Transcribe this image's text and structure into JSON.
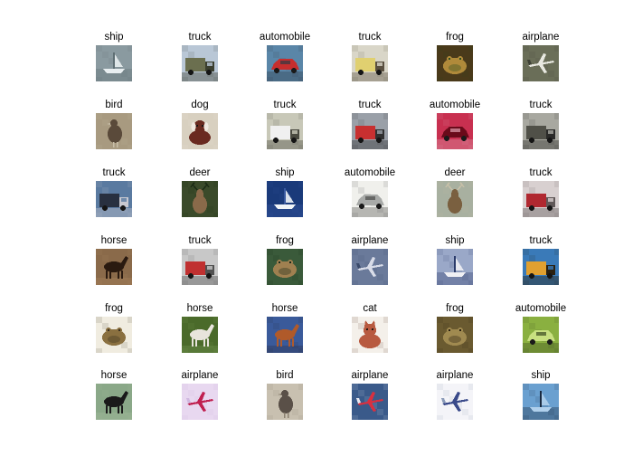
{
  "rows": [
    {
      "items": [
        {
          "label": "ship",
          "palette": [
            "#8a9aa0",
            "#e8eef0",
            "#5f6f74"
          ],
          "motif": "ship"
        },
        {
          "label": "truck",
          "palette": [
            "#b9c7d6",
            "#6b6f4f",
            "#3b3f2f"
          ],
          "motif": "truck"
        },
        {
          "label": "automobile",
          "palette": [
            "#5a86a8",
            "#c62e2e",
            "#2f3a45"
          ],
          "motif": "car"
        },
        {
          "label": "truck",
          "palette": [
            "#d9d6c8",
            "#e0d070",
            "#5a5040"
          ],
          "motif": "truck"
        },
        {
          "label": "frog",
          "palette": [
            "#4a3a1a",
            "#b08a3a",
            "#2c4a1f"
          ],
          "motif": "frog"
        },
        {
          "label": "airplane",
          "palette": [
            "#6a6e58",
            "#e8e8e0",
            "#3f4236"
          ],
          "motif": "plane"
        }
      ]
    },
    {
      "items": [
        {
          "label": "bird",
          "palette": [
            "#a89a80",
            "#5a4a3a",
            "#c8bea8"
          ],
          "motif": "bird"
        },
        {
          "label": "dog",
          "palette": [
            "#d8d0c0",
            "#6a2a20",
            "#f0e8e0"
          ],
          "motif": "dog"
        },
        {
          "label": "truck",
          "palette": [
            "#c8c8b8",
            "#f0f0f0",
            "#4a4a40"
          ],
          "motif": "truck"
        },
        {
          "label": "truck",
          "palette": [
            "#9aa0a8",
            "#c83030",
            "#303030"
          ],
          "motif": "truck"
        },
        {
          "label": "automobile",
          "palette": [
            "#c83050",
            "#6a0a1a",
            "#e0a0b0"
          ],
          "motif": "car"
        },
        {
          "label": "truck",
          "palette": [
            "#a8a8a0",
            "#505048",
            "#2a2a28"
          ],
          "motif": "truck"
        }
      ]
    },
    {
      "items": [
        {
          "label": "truck",
          "palette": [
            "#5a7aa0",
            "#283040",
            "#c8c8d0"
          ],
          "motif": "truck"
        },
        {
          "label": "deer",
          "palette": [
            "#3a4a2a",
            "#8a6a4a",
            "#1a2a14"
          ],
          "motif": "deer"
        },
        {
          "label": "ship",
          "palette": [
            "#1a3a7a",
            "#f0f4f8",
            "#3a5aa0"
          ],
          "motif": "ship"
        },
        {
          "label": "automobile",
          "palette": [
            "#f0f0ec",
            "#a8aaa8",
            "#4a4a48"
          ],
          "motif": "car"
        },
        {
          "label": "deer",
          "palette": [
            "#a8b0a0",
            "#7a6040",
            "#c8c0a8"
          ],
          "motif": "deer"
        },
        {
          "label": "truck",
          "palette": [
            "#d8d0d0",
            "#b02830",
            "#605858"
          ],
          "motif": "truck"
        }
      ]
    },
    {
      "items": [
        {
          "label": "horse",
          "palette": [
            "#8a6a4a",
            "#2a1a10",
            "#b08860"
          ],
          "motif": "horse"
        },
        {
          "label": "truck",
          "palette": [
            "#c8c8c8",
            "#c03030",
            "#505050"
          ],
          "motif": "truck"
        },
        {
          "label": "frog",
          "palette": [
            "#3a5a3a",
            "#a08050",
            "#1a2a1a"
          ],
          "motif": "frog"
        },
        {
          "label": "airplane",
          "palette": [
            "#6a7a9a",
            "#d8dce8",
            "#3a4a6a"
          ],
          "motif": "plane"
        },
        {
          "label": "ship",
          "palette": [
            "#9aa8c8",
            "#f0f0f4",
            "#2a3a6a"
          ],
          "motif": "ship"
        },
        {
          "label": "truck",
          "palette": [
            "#3a7ab8",
            "#e0a030",
            "#2a2010"
          ],
          "motif": "truck"
        }
      ]
    },
    {
      "items": [
        {
          "label": "frog",
          "palette": [
            "#f0ece0",
            "#8a7040",
            "#3a3020"
          ],
          "motif": "frog"
        },
        {
          "label": "horse",
          "palette": [
            "#4a6a2a",
            "#e8e4dc",
            "#7a9a5a"
          ],
          "motif": "horse"
        },
        {
          "label": "horse",
          "palette": [
            "#3a5a9a",
            "#b05a2a",
            "#2a2a3a"
          ],
          "motif": "horse"
        },
        {
          "label": "cat",
          "palette": [
            "#f4f0ea",
            "#b85a40",
            "#503020"
          ],
          "motif": "cat"
        },
        {
          "label": "frog",
          "palette": [
            "#6a5a30",
            "#a08a50",
            "#2a2010"
          ],
          "motif": "frog"
        },
        {
          "label": "automobile",
          "palette": [
            "#8ab040",
            "#c8e080",
            "#3a4a20"
          ],
          "motif": "car"
        }
      ]
    },
    {
      "items": [
        {
          "label": "horse",
          "palette": [
            "#8aa888",
            "#1a1a1a",
            "#a8c0a0"
          ],
          "motif": "horse"
        },
        {
          "label": "airplane",
          "palette": [
            "#e8d8f0",
            "#c02050",
            "#d0b8e0"
          ],
          "motif": "plane"
        },
        {
          "label": "bird",
          "palette": [
            "#c8c0b0",
            "#5a5048",
            "#8a8070"
          ],
          "motif": "bird"
        },
        {
          "label": "airplane",
          "palette": [
            "#3a5a8a",
            "#d83040",
            "#e8e8f0"
          ],
          "motif": "plane"
        },
        {
          "label": "airplane",
          "palette": [
            "#f4f4f8",
            "#3a4a8a",
            "#8a9ab8"
          ],
          "motif": "plane"
        },
        {
          "label": "ship",
          "palette": [
            "#6aa0d0",
            "#b0d0ec",
            "#1a2a40"
          ],
          "motif": "ship"
        }
      ]
    }
  ]
}
